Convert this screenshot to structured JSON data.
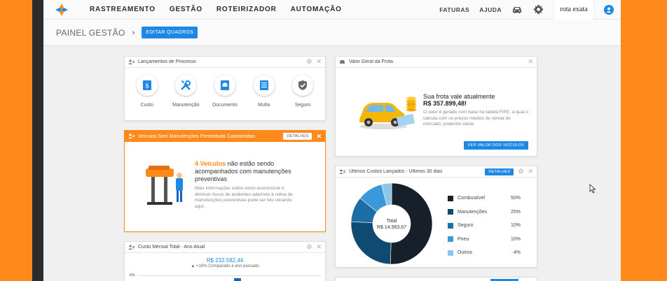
{
  "nav": {
    "items": [
      "RASTREAMENTO",
      "GESTÃO",
      "ROTEIRIZADOR",
      "AUTOMAÇÃO"
    ],
    "faturas": "FATURAS",
    "ajuda": "AJUDA",
    "brand": "rota exata"
  },
  "page": {
    "title": "PAINEL GESTÃO",
    "edit_button": "EDITAR QUADROS"
  },
  "launches": {
    "title": "Lançamentos de Processo",
    "items": [
      {
        "label": "Custo",
        "icon": "dollar-document-icon"
      },
      {
        "label": "Manutenção",
        "icon": "wrench-screwdriver-icon"
      },
      {
        "label": "Documento",
        "icon": "car-document-icon"
      },
      {
        "label": "Multa",
        "icon": "fine-document-icon"
      },
      {
        "label": "Seguro",
        "icon": "shield-check-icon"
      }
    ]
  },
  "maintenance": {
    "title": "Veículos Sem Manutenções Preventivas Cadastradas",
    "details": "DETALHES",
    "highlight": "4 Veículos",
    "message": " não estão sendo acompanhados com manutenções preventivas",
    "info": "Mais informações sobre como economizar e diminuir riscos de acidentes aderindo à rotina de manutenções preventivas pode ser lido clicando aqui."
  },
  "monthly": {
    "title": "Custo Mensal Total - Ano Atual",
    "value": "R$ 232.582,44",
    "comparison": "+18% Comparado à ano passado",
    "y_tick": "30k"
  },
  "fleet": {
    "title": "Valor Geral da Frota",
    "headline": "Sua frota vale atualmente",
    "value": "R$ 357.899,48!",
    "description": "O valor é gerado com base na tabela FIPE, a qual o calcula com os preços médios de venda do mercado, podendo variar.",
    "button": "VER VALOR DOS VEÍCULOS"
  },
  "costs": {
    "title": "Últimos Custos Lançados - Últimos 30 dias",
    "details": "DETALHES",
    "center_label": "Total",
    "center_value": "R$ 14.563,67"
  },
  "chart_data": {
    "type": "pie",
    "title": "Últimos Custos Lançados - Últimos 30 dias",
    "categories": [
      "Combustível",
      "Manutenções",
      "Seguro",
      "Pneu",
      "Outros"
    ],
    "values": [
      50,
      25,
      10,
      10,
      4
    ],
    "labels": [
      "50%",
      "25%",
      "10%",
      "10%",
      "4%"
    ],
    "colors": [
      "#17202a",
      "#0f4a73",
      "#1c6ea4",
      "#3a9ad9",
      "#8ec6ea"
    ],
    "legend": "right"
  }
}
